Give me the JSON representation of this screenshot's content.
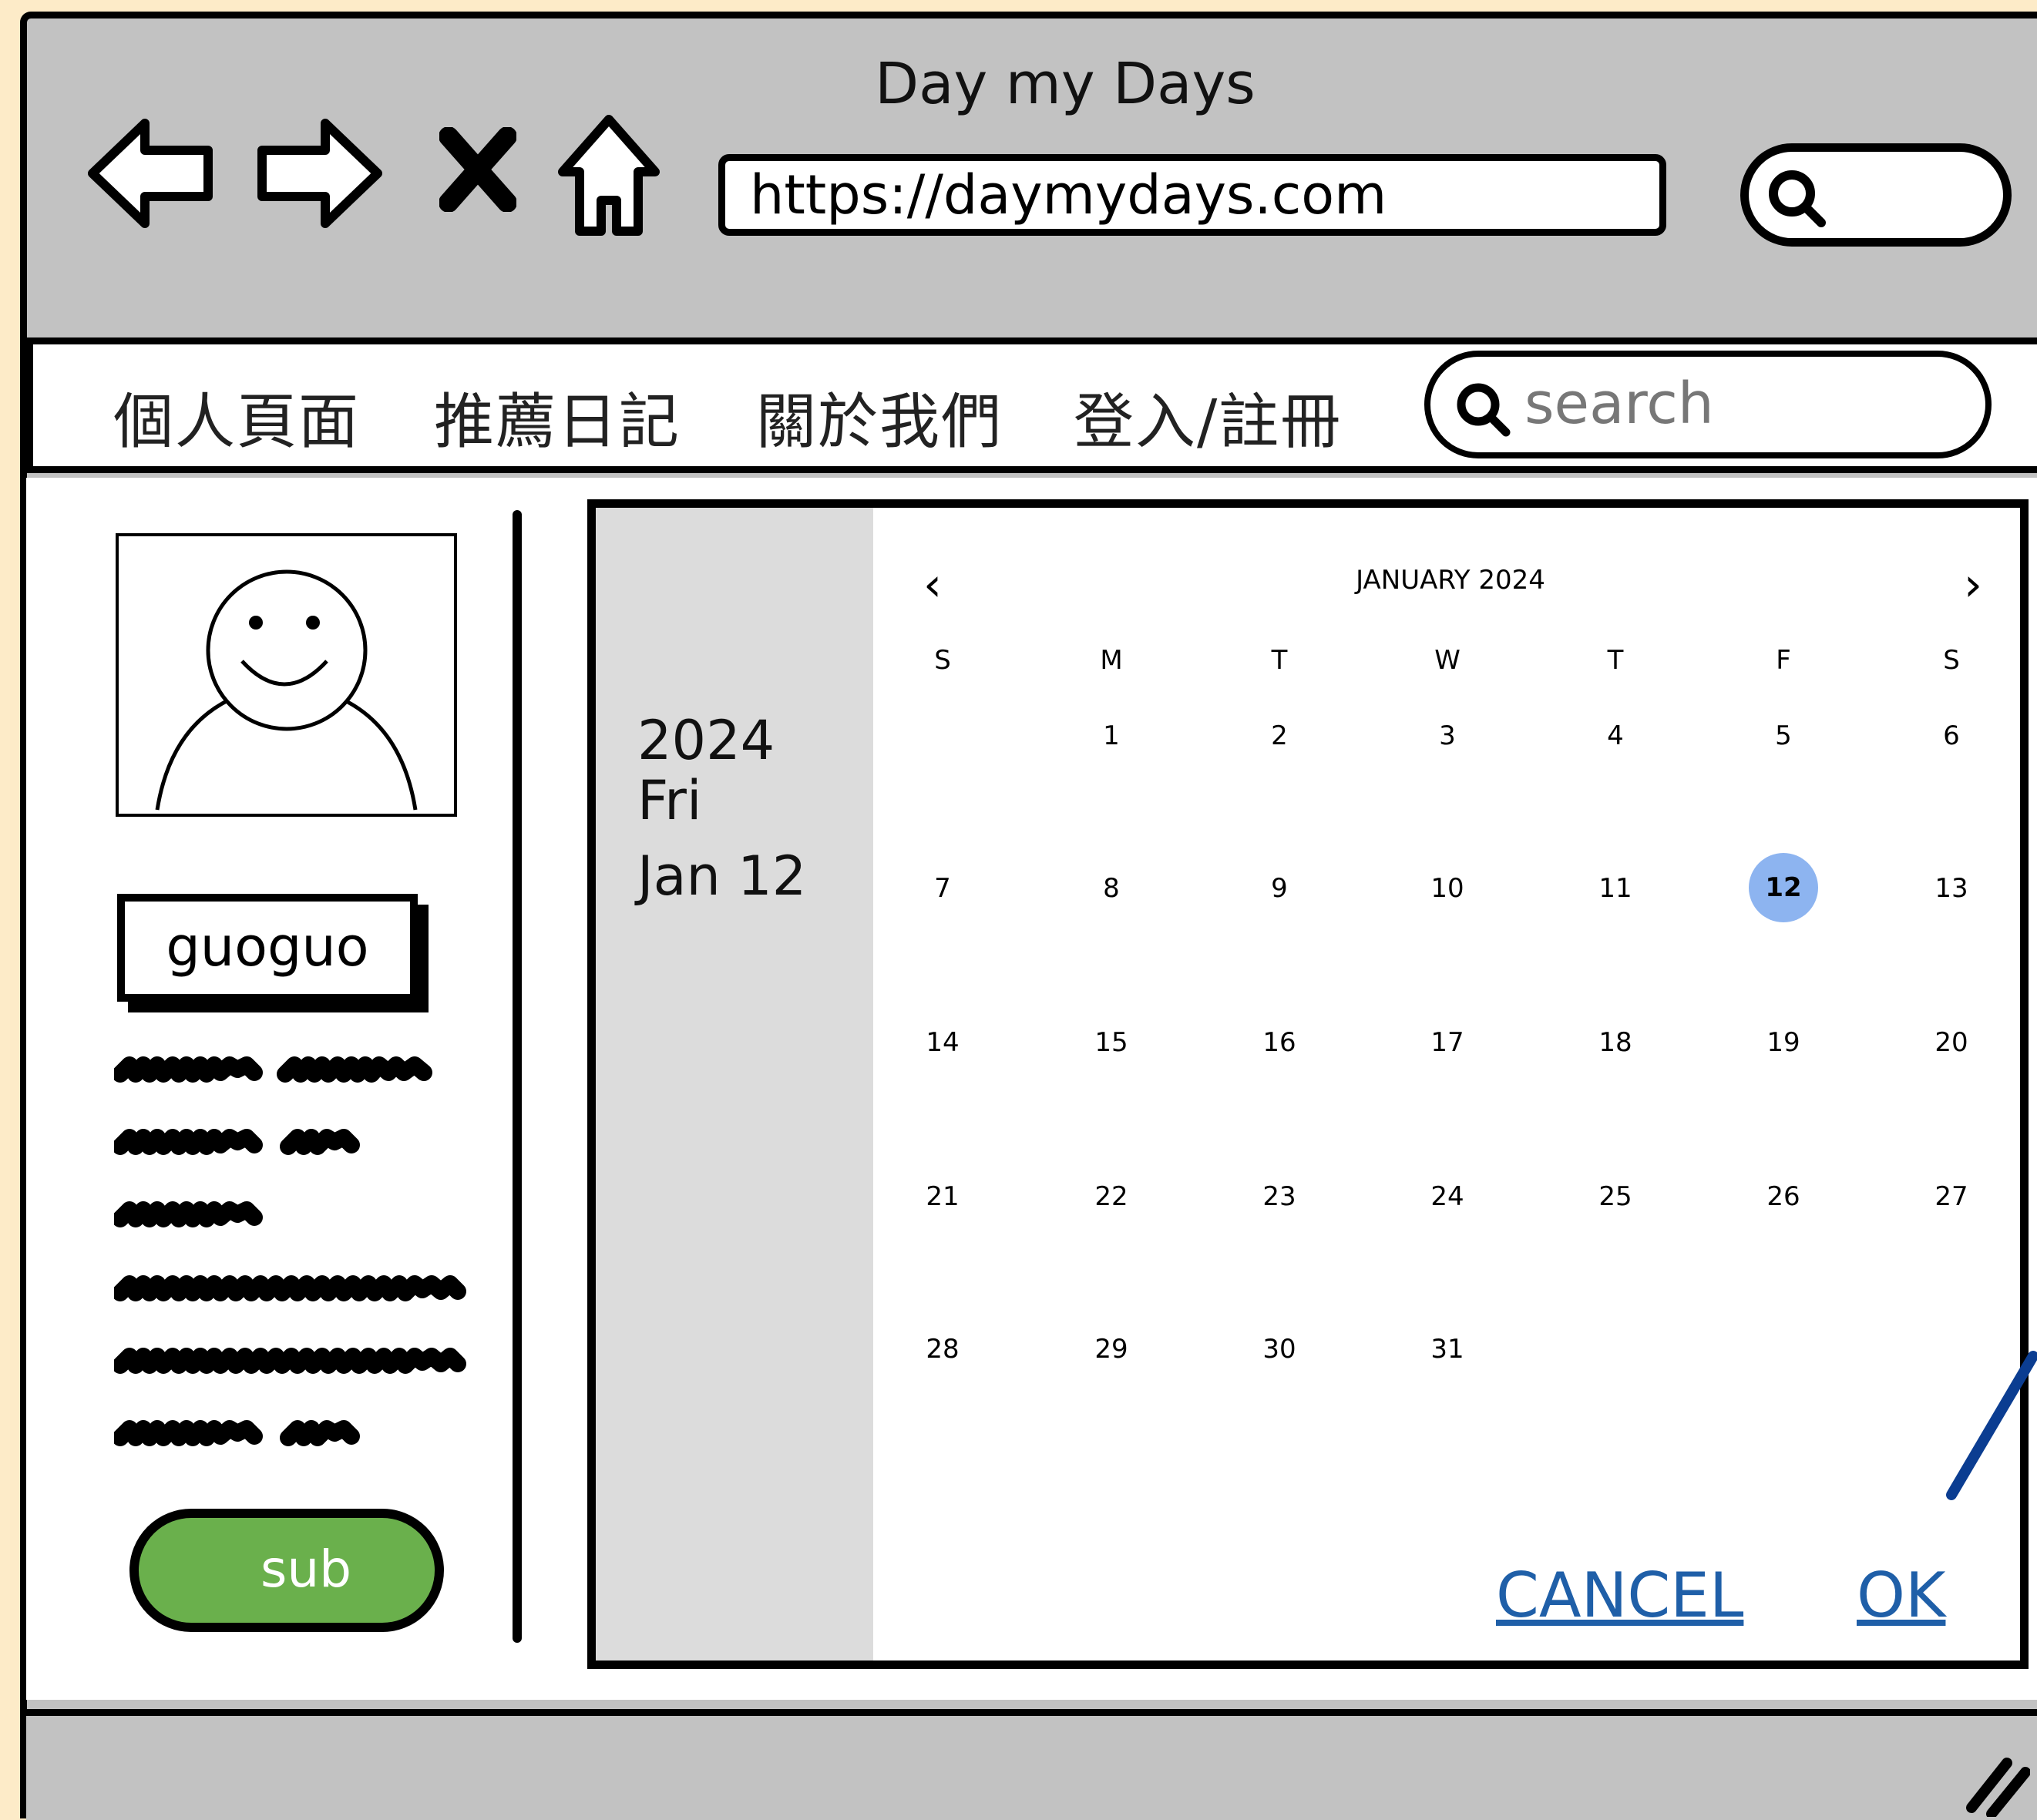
{
  "browser": {
    "title": "Day my Days",
    "url": "https://daymydays.com",
    "nav_icons": [
      "back-arrow-icon",
      "forward-arrow-icon",
      "close-icon",
      "home-icon"
    ]
  },
  "navbar": {
    "items": [
      "個人頁面",
      "推薦日記",
      "關於我們",
      "登入/註冊"
    ],
    "search_placeholder": "search"
  },
  "profile": {
    "username": "guoguo",
    "subscribe_label": "sub"
  },
  "date_picker": {
    "selected_year": "2024",
    "selected_weekday": "Fri",
    "selected_date": "Jan 12",
    "month_label": "JANUARY 2024",
    "weekday_headers": [
      "S",
      "M",
      "T",
      "W",
      "T",
      "F",
      "S"
    ],
    "weeks": [
      [
        "",
        "1",
        "2",
        "3",
        "4",
        "5",
        "6"
      ],
      [
        "7",
        "8",
        "9",
        "10",
        "11",
        "12",
        "13"
      ],
      [
        "14",
        "15",
        "16",
        "17",
        "18",
        "19",
        "20"
      ],
      [
        "21",
        "22",
        "23",
        "24",
        "25",
        "26",
        "27"
      ],
      [
        "28",
        "29",
        "30",
        "31",
        "",
        "",
        ""
      ]
    ],
    "selected_day": "12",
    "cancel_label": "CANCEL",
    "ok_label": "OK"
  },
  "colors": {
    "page_background": "#fdebc8",
    "chrome_gray": "#c2c2c2",
    "subscribe_green": "#6ab04c",
    "selected_day": "#8db4f0",
    "action_link": "#1f5fa8"
  }
}
